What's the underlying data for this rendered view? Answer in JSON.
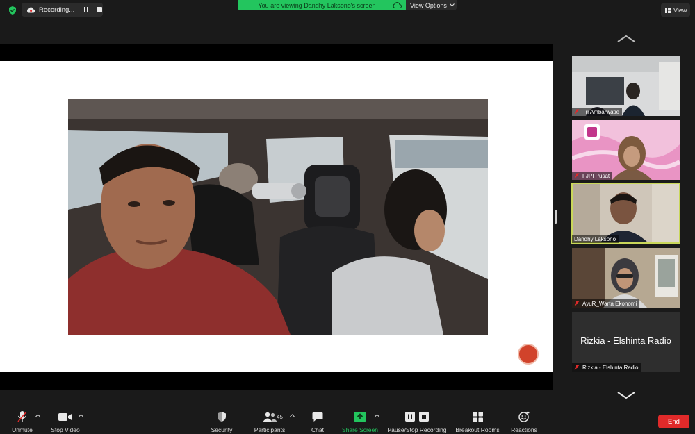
{
  "topbar": {
    "recording_label": "Recording...",
    "viewing_banner": "You are viewing Dandhy Laksono's screen",
    "view_options_label": "View Options",
    "view_button_label": "View"
  },
  "gallery": {
    "tiles": [
      {
        "name": "Tri Ambarwatie"
      },
      {
        "name": "FJPI Pusat"
      },
      {
        "name": "Dandhy Laksono"
      },
      {
        "name": "AyuR_Warta Ekonomi"
      },
      {
        "name": "Rizkia - Elshinta Radio",
        "display_name": "Rizkia - Elshinta Radio"
      }
    ]
  },
  "toolbar": {
    "unmute": "Unmute",
    "stop_video": "Stop Video",
    "security": "Security",
    "participants": "Participants",
    "participants_count": "45",
    "chat": "Chat",
    "share_screen": "Share Screen",
    "pause_stop_recording": "Pause/Stop Recording",
    "breakout_rooms": "Breakout Rooms",
    "reactions": "Reactions",
    "end": "End"
  },
  "colors": {
    "accent_green": "#23c55e",
    "end_red": "#e02a2a",
    "active_speaker": "#c9d75a",
    "background": "#1a1a1a"
  }
}
